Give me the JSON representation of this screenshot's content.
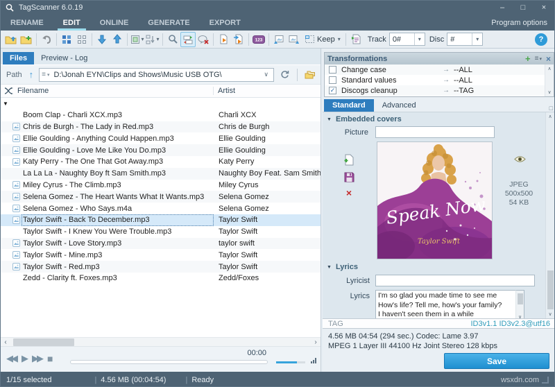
{
  "window": {
    "title": "TagScanner 6.0.19",
    "watermark": "wsxdn.com"
  },
  "glyphs": {
    "dropdown": "▾",
    "triangle_down": "▼",
    "chevron_up": "∧",
    "chevron_down": "∨",
    "scroll_left": "‹",
    "scroll_right": "›",
    "minimize": "–",
    "maximize": "□",
    "close": "×",
    "help": "?",
    "up": "↑",
    "menu": "≡",
    "plus": "+",
    "delete": "×",
    "rewind": "◀◀",
    "play": "▶",
    "forward": "▶▶",
    "stop": "■",
    "arrow_right": "→",
    "renumber_label": "123"
  },
  "menu": {
    "items": [
      "RENAME",
      "EDIT",
      "ONLINE",
      "GENERATE",
      "EXPORT"
    ],
    "active": "EDIT",
    "right_label": "Program options"
  },
  "toolbar": {
    "keep_label": "Keep",
    "track_label": "Track",
    "track_value": "0#",
    "disc_label": "Disc",
    "disc_value": "#"
  },
  "doc_tabs": {
    "files": "Files",
    "preview": "Preview - Log"
  },
  "path": {
    "label": "Path",
    "value": "D:\\Jonah EYN\\Clips and Shows\\Music USB OTG\\"
  },
  "filelist": {
    "columns": {
      "filename": "Filename",
      "artist": "Artist"
    },
    "rows": [
      {
        "type": "group"
      },
      {
        "filename": "Boom Clap - Charli XCX.mp3",
        "artist": "Charli XCX",
        "icon": false
      },
      {
        "filename": "Chris de Burgh - The Lady in Red.mp3",
        "artist": "Chris de Burgh",
        "icon": true
      },
      {
        "filename": "Ellie Goulding - Anything Could Happen.mp3",
        "artist": "Ellie Goulding",
        "icon": true
      },
      {
        "filename": "Ellie Goulding - Love Me Like You Do.mp3",
        "artist": "Ellie Goulding",
        "icon": true
      },
      {
        "filename": "Katy Perry - The One That Got Away.mp3",
        "artist": "Katy Perry",
        "icon": true
      },
      {
        "filename": "La La La - Naughty Boy ft Sam Smith.mp3",
        "artist": "Naughty Boy Feat. Sam Smith",
        "icon": false
      },
      {
        "filename": "Miley Cyrus - The Climb.mp3",
        "artist": "Miley Cyrus",
        "icon": true
      },
      {
        "filename": "Selena Gomez - The Heart Wants What It Wants.mp3",
        "artist": "Selena Gomez",
        "icon": true
      },
      {
        "filename": "Selena Gomez - Who Says.m4a",
        "artist": "Selena Gomez",
        "icon": true
      },
      {
        "filename": "Taylor Swift - Back To December.mp3",
        "artist": "Taylor Swift",
        "icon": true,
        "selected": true
      },
      {
        "filename": "Taylor Swift - I Knew You Were Trouble.mp3",
        "artist": "Taylor Swift",
        "icon": false
      },
      {
        "filename": "Taylor Swift - Love Story.mp3",
        "artist": "taylor swift",
        "icon": true
      },
      {
        "filename": "Taylor Swift - Mine.mp3",
        "artist": "Taylor Swift",
        "icon": true
      },
      {
        "filename": "Taylor Swift - Red.mp3",
        "artist": "Taylor Swift",
        "icon": true
      },
      {
        "filename": "Zedd - Clarity ft. Foxes.mp3",
        "artist": "Zedd/Foxes",
        "icon": false
      }
    ]
  },
  "player": {
    "time": "00:00"
  },
  "transformations": {
    "title": "Transformations",
    "rows": [
      {
        "label": "Change case",
        "check": "",
        "target": "--ALL"
      },
      {
        "label": "Standard values",
        "check": "",
        "target": "--ALL"
      },
      {
        "label": "Discogs cleanup",
        "check": "✓",
        "target": "--TAG"
      }
    ]
  },
  "editor": {
    "tabs": {
      "standard": "Standard",
      "advanced": "Advanced"
    },
    "covers": {
      "section": "Embedded covers",
      "picture_label": "Picture",
      "format": "JPEG",
      "dimensions": "500x500",
      "size": "54 KB",
      "album_title": "Speak Now",
      "album_artist": "Taylor Swift"
    },
    "lyrics": {
      "section": "Lyrics",
      "lyricist_label": "Lyricist",
      "lyrics_label": "Lyrics",
      "text": "I'm so glad you made time to see me\nHow's life? Tell me, how's your family?\nI haven't seen them in a while"
    },
    "tag": {
      "label": "TAG",
      "formats": "ID3v1.1 ID3v2.3@utf16"
    },
    "info_line1": "4.56 MB  04:54 (294 sec.)  Codec: Lame 3.97",
    "info_line2": "MPEG 1 Layer III  44100 Hz  Joint Stereo  128 kbps",
    "save_label": "Save"
  },
  "status": {
    "selected": "1/15 selected",
    "size": "4.56 MB (00:04:54)",
    "state": "Ready",
    "separator": "|"
  },
  "colors": {
    "accent_blue": "#2e7dbe",
    "save_blue": "#1f8fd0",
    "titlebar": "#4e6374",
    "tag_format": "#2f9cba"
  }
}
